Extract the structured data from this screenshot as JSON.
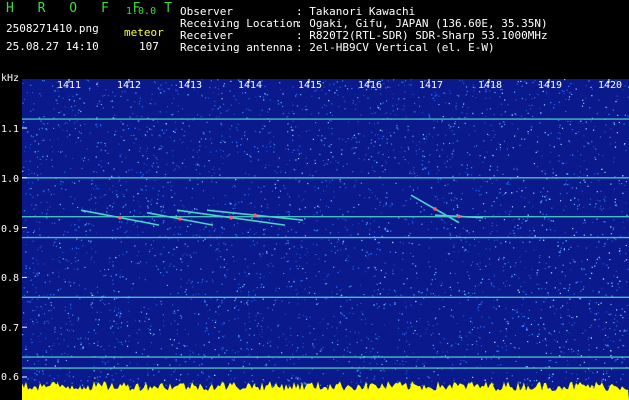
{
  "header": {
    "app_name": "H R O F F T",
    "version": "1.0.0",
    "filename": "2508271410.png",
    "timestamp": "25.08.27 14:10",
    "meteor_label": "meteor",
    "meteor_count": "107",
    "fields": [
      {
        "label": "Observer",
        "value": ": Takanori Kawachi"
      },
      {
        "label": "Receiving Location",
        "value": ": Ogaki, Gifu, JAPAN (136.60E, 35.35N)"
      },
      {
        "label": "Receiver",
        "value": ": R820T2(RTL-SDR) SDR-Sharp 53.1000MHz"
      },
      {
        "label": "Receiving antenna",
        "value": ": 2el-HB9CV Vertical (el. E-W)"
      }
    ]
  },
  "spectrogram": {
    "freq_unit": "kHz",
    "y_ticks": [
      "1.1",
      "1.0",
      "0.9",
      "0.8",
      "0.7",
      "0.6"
    ],
    "y_tick_values": [
      1.1,
      1.0,
      0.9,
      0.8,
      0.7,
      0.6
    ],
    "x_ticks": [
      "1411",
      "1412",
      "1413",
      "1414",
      "1415",
      "1416",
      "1417",
      "1418",
      "1419",
      "1420"
    ],
    "background_color": "#0a1a8c",
    "noise_color": "#2a6cff",
    "line_color": "#4fd0c8",
    "meteor_color": "#ff5a6a",
    "floor_color": "#ffff00",
    "carriers_khz": [
      1.118,
      1.0,
      0.922,
      0.88,
      0.76,
      0.64,
      0.618
    ],
    "meteors": [
      {
        "t0": 1411.2,
        "f0": 0.935,
        "t1": 1412.5,
        "f1": 0.905
      },
      {
        "t0": 1412.3,
        "f0": 0.93,
        "t1": 1413.4,
        "f1": 0.905
      },
      {
        "t0": 1412.8,
        "f0": 0.935,
        "t1": 1414.6,
        "f1": 0.905
      },
      {
        "t0": 1413.3,
        "f0": 0.935,
        "t1": 1414.9,
        "f1": 0.915
      },
      {
        "t0": 1416.7,
        "f0": 0.965,
        "t1": 1417.5,
        "f1": 0.91
      },
      {
        "t0": 1417.1,
        "f0": 0.925,
        "t1": 1417.9,
        "f1": 0.92
      }
    ]
  }
}
